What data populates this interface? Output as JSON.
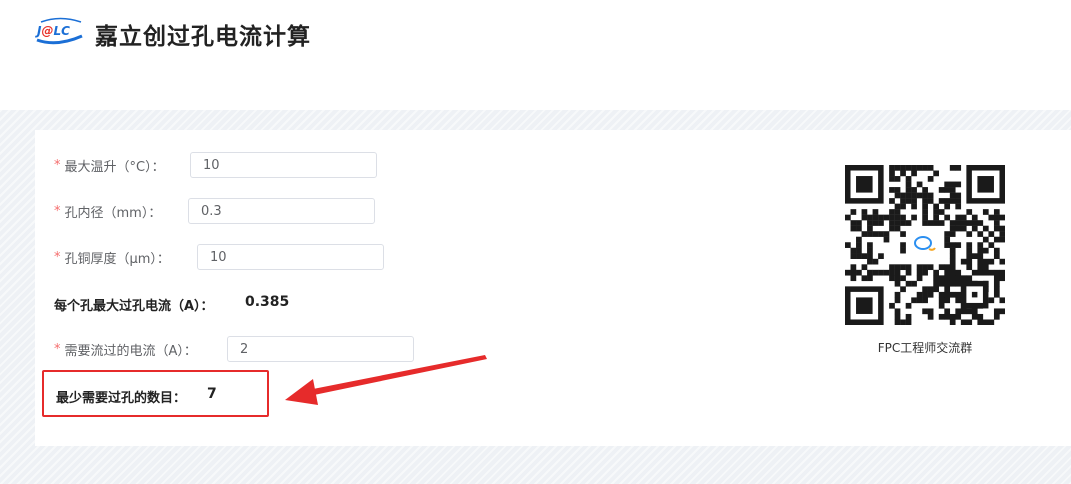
{
  "header": {
    "logo_text": "J@LC",
    "title": "嘉立创过孔电流计算"
  },
  "form": {
    "fields": [
      {
        "label": "最大温升（°C）：",
        "value": "10"
      },
      {
        "label": "孔内径（mm）：",
        "value": "0.3"
      },
      {
        "label": "孔铜厚度（μm）：",
        "value": "10"
      },
      {
        "label": "需要流过的电流（A）：",
        "value": "2"
      }
    ],
    "required_mark": "*",
    "max_current_label": "每个孔最大过孔电流（A）：",
    "max_current_value": "0.385",
    "min_vias_label": "最少需要过孔的数目：",
    "min_vias_value": "7"
  },
  "qr": {
    "caption": "FPC工程师交流群",
    "icon": "qq-group-icon"
  },
  "colors": {
    "required": "#f56c6c",
    "highlight_box": "#e62b2b",
    "logo_blue": "#1b6fd6",
    "logo_red": "#e8322b"
  }
}
